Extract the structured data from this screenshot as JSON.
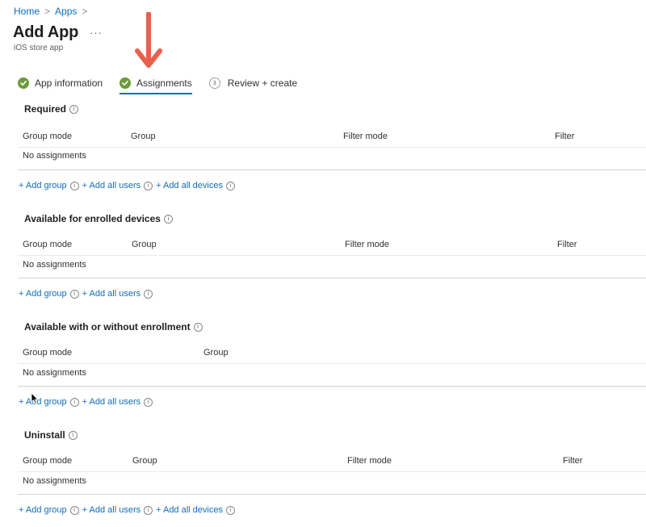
{
  "breadcrumb": {
    "home": "Home",
    "apps": "Apps",
    "sep": ">"
  },
  "page": {
    "title": "Add App",
    "more": "···",
    "subtitle": "iOS store app"
  },
  "tabs": [
    {
      "label": "App information",
      "state": "complete"
    },
    {
      "label": "Assignments",
      "state": "active"
    },
    {
      "label": "Review + create",
      "state": "pending",
      "number": "3"
    }
  ],
  "columns": {
    "group_mode": "Group mode",
    "group": "Group",
    "filter_mode": "Filter mode",
    "filter": "Filter"
  },
  "empty_text": "No assignments",
  "links": {
    "add_group": "+ Add group",
    "add_all_users": "+ Add all users",
    "add_all_devices": "+ Add all devices"
  },
  "sections": [
    {
      "title": "Required"
    },
    {
      "title": "Available for enrolled devices"
    },
    {
      "title": "Available with or without enrollment"
    },
    {
      "title": "Uninstall"
    }
  ],
  "info_glyph": "i",
  "colors": {
    "link": "#0f6cbd",
    "check": "#6a9a3c",
    "arrow": "#e8604c",
    "tab_underline": "#0f6cbd"
  },
  "icons": {
    "complete": "check-circle-icon",
    "info": "info-icon",
    "annotation": "red-down-arrow-icon",
    "pointer": "mouse-pointer-icon"
  }
}
